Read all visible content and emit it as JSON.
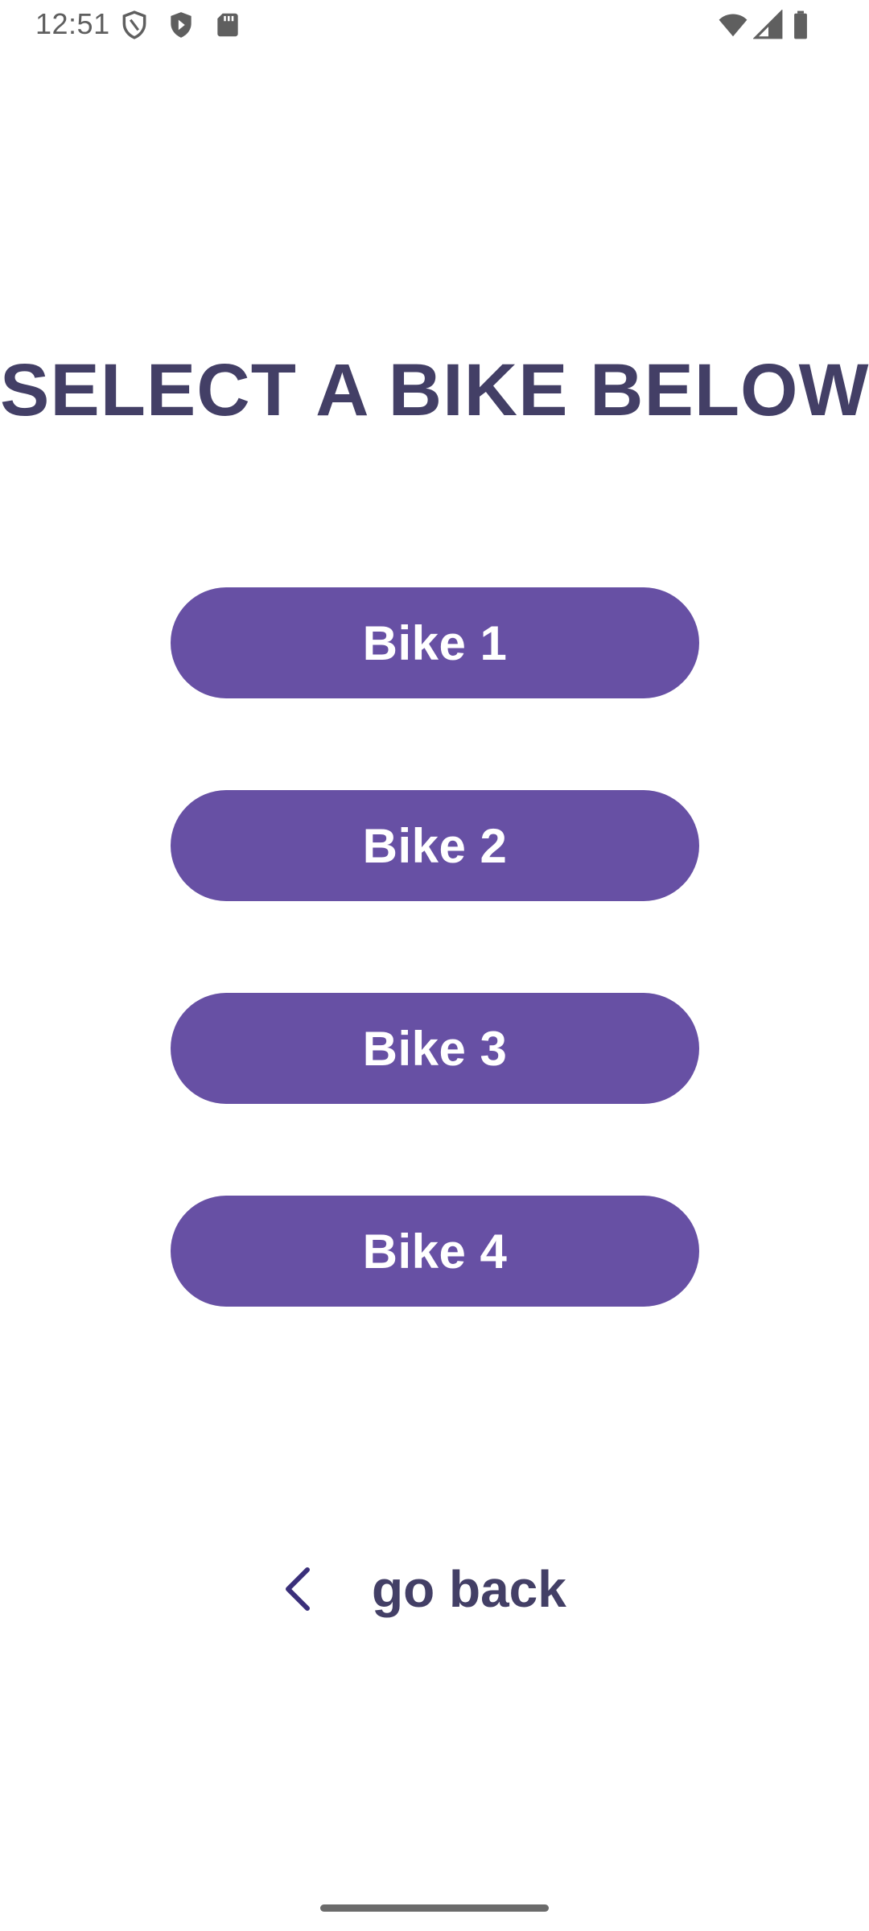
{
  "status_bar": {
    "time": "12:51",
    "icons_left": [
      "shield-outline-icon",
      "play-shield-icon",
      "sd-card-icon"
    ],
    "icons_right": [
      "wifi-icon",
      "cell-signal-icon",
      "battery-icon"
    ],
    "icon_color": "#5f5f5f"
  },
  "main": {
    "title": "SELECT A BIKE BELOW:",
    "title_color": "#433f66",
    "button_color": "#6750a4",
    "buttons": [
      {
        "label": "Bike 1"
      },
      {
        "label": "Bike 2"
      },
      {
        "label": "Bike 3"
      },
      {
        "label": "Bike 4"
      }
    ]
  },
  "footer": {
    "back_label": "go back",
    "back_icon": "chevron-left-icon"
  }
}
